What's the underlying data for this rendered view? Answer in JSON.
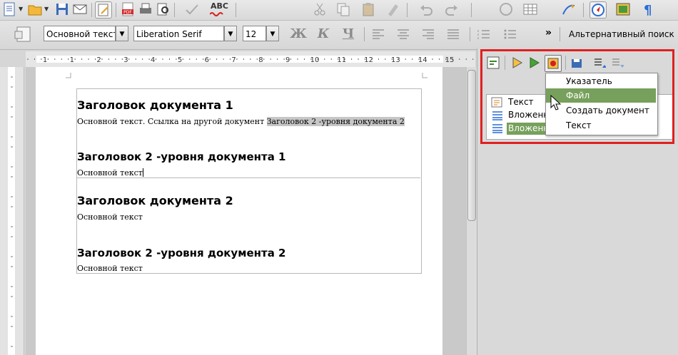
{
  "toolbar": {
    "style_value": "Основной текст",
    "font_value": "Liberation Serif",
    "size_value": "12",
    "bold_label": "Ж",
    "italic_label": "К",
    "underline_label": "Ч",
    "more_label": "»",
    "alt_search_label": "Альтернативный поиск",
    "spell_label": "ABC"
  },
  "ruler": {
    "labels": [
      "1",
      "1",
      "2",
      "3",
      "4",
      "5",
      "6",
      "7",
      "8",
      "9",
      "10",
      "11",
      "12",
      "13",
      "14",
      "15"
    ]
  },
  "document": {
    "h1a": "Заголовок документа 1",
    "p1_text": "Основной текст. Ссылка на другой документ ",
    "p1_link": "Заголовок 2 -уровня документа 2",
    "h2a": "Заголовок 2 -уровня документа 1",
    "p2": "Основной текст",
    "h1b": "Заголовок документа 2",
    "p3": "Основной текст",
    "h2b": "Заголовок 2 -уровня документа 2",
    "p4": "Основной текст"
  },
  "navigator": {
    "items": [
      "Текст",
      "Вложенн",
      "Вложенн"
    ]
  },
  "menu": {
    "items": [
      "Указатель",
      "Файл",
      "Создать документ",
      "Текст"
    ],
    "selected": "Файл"
  },
  "colors": {
    "highlight": "#77a05c",
    "frame": "#e02020"
  }
}
